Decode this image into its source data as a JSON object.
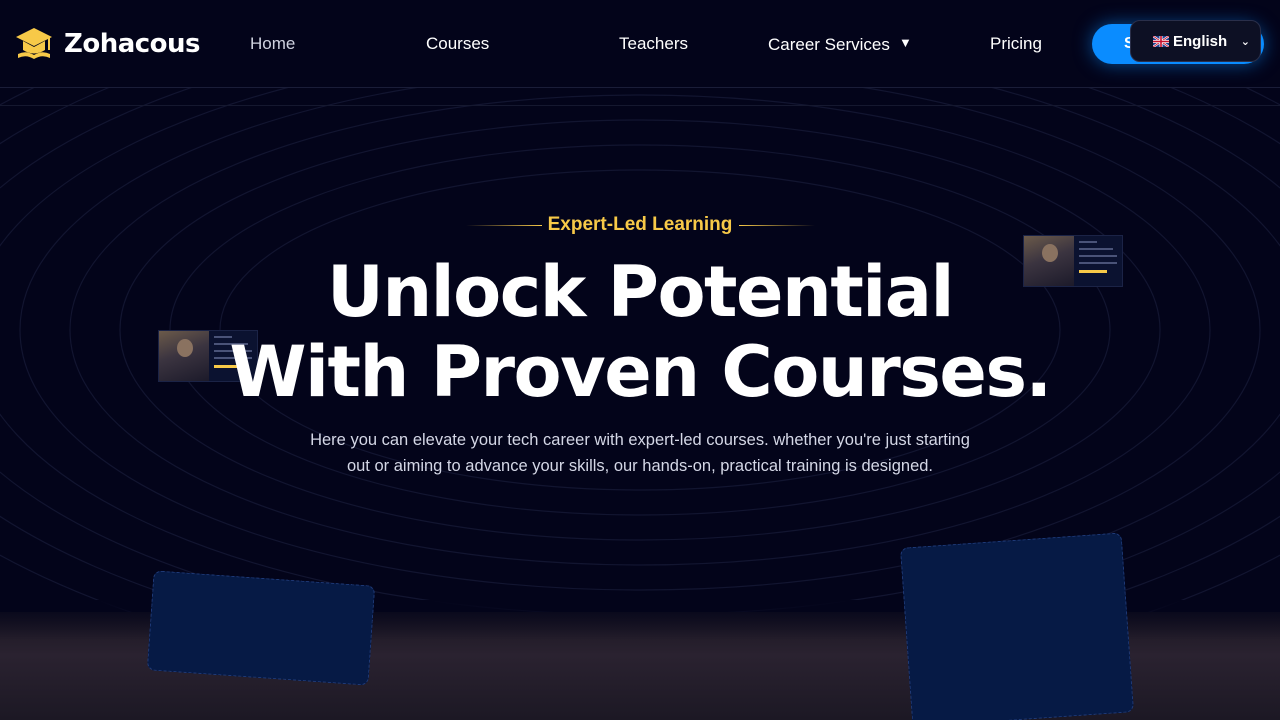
{
  "brand": {
    "name": "Zohacous",
    "accent": "#f7c948",
    "primary": "#0a8cff",
    "background": "#03041a"
  },
  "nav": {
    "items": [
      {
        "label": "Home"
      },
      {
        "label": "Courses"
      },
      {
        "label": "Teachers"
      },
      {
        "label": "Career Services",
        "has_dropdown": true
      },
      {
        "label": "Pricing"
      }
    ],
    "cta_label": "S",
    "language": {
      "selected": "English",
      "icon": "uk-flag-icon"
    }
  },
  "hero": {
    "eyebrow": "Expert-Led Learning",
    "headline_line1": "Unlock Potential",
    "headline_line2": "With Proven Courses.",
    "subtext_line1": "Here you can elevate your tech career with expert-led courses. whether you're just starting",
    "subtext_line2": "out or aiming to advance your skills, our hands-on, practical training is designed."
  }
}
